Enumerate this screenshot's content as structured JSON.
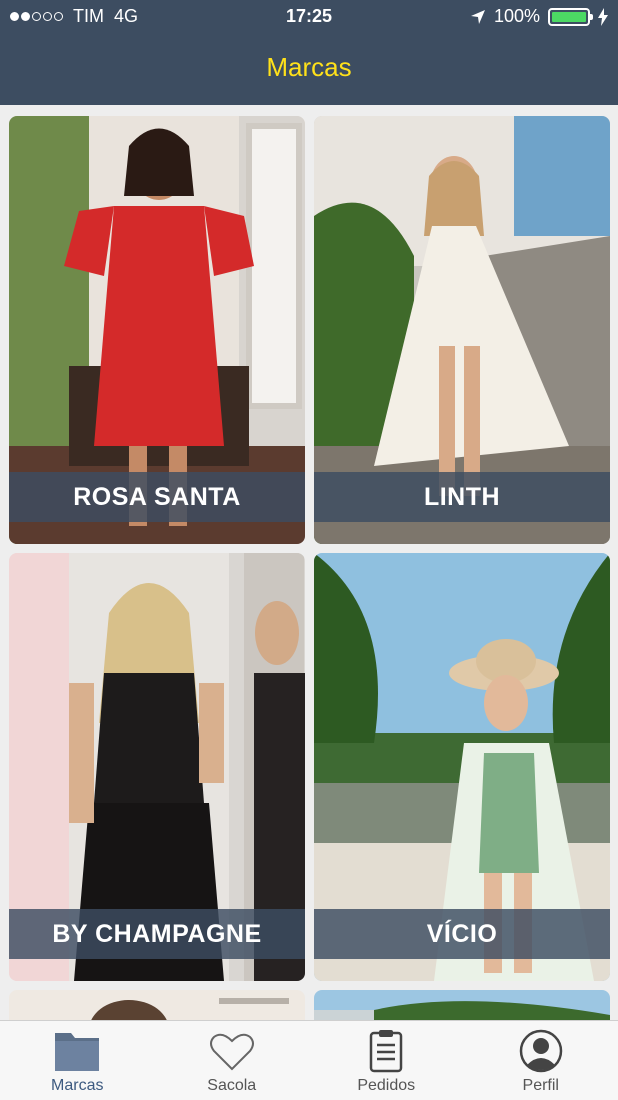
{
  "status_bar": {
    "carrier": "TIM",
    "network": "4G",
    "time": "17:25",
    "battery": "100%"
  },
  "header": {
    "title": "Marcas"
  },
  "brands": [
    {
      "name": "ROSA SANTA"
    },
    {
      "name": "LINTH"
    },
    {
      "name": "BY CHAMPAGNE"
    },
    {
      "name": "VÍCIO"
    }
  ],
  "tabs": [
    {
      "label": "Marcas",
      "icon": "folder-icon",
      "active": true
    },
    {
      "label": "Sacola",
      "icon": "heart-icon",
      "active": false
    },
    {
      "label": "Pedidos",
      "icon": "clipboard-icon",
      "active": false
    },
    {
      "label": "Perfil",
      "icon": "profile-icon",
      "active": false
    }
  ],
  "colors": {
    "header_bg": "#3d4d61",
    "title": "#ffe11a",
    "battery": "#4cd964",
    "active_tab": "#3d5a80"
  }
}
